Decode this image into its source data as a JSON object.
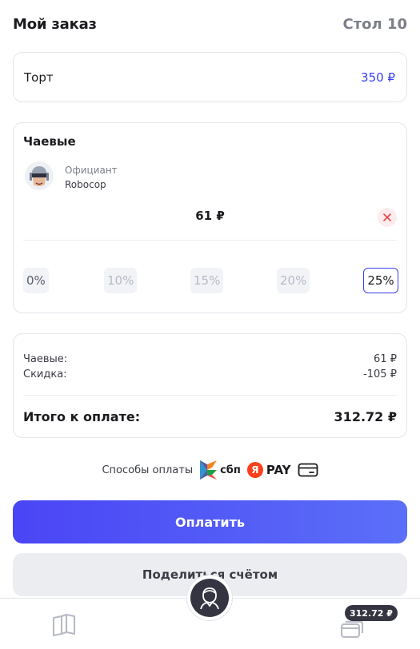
{
  "header": {
    "title": "Мой заказ",
    "table": "Стол 10"
  },
  "order": {
    "items": [
      {
        "name": "Торт",
        "price": "350 ₽"
      }
    ]
  },
  "tips": {
    "title": "Чаевые",
    "waiter_role": "Официант",
    "waiter_name": "Robocop",
    "amount": "61 ₽",
    "options": [
      "0%",
      "10%",
      "15%",
      "20%",
      "25%"
    ],
    "selected": "25%"
  },
  "summary": {
    "tips_label": "Чаевые:",
    "tips_value": "61 ₽",
    "discount_label": "Скидка:",
    "discount_value": "-105 ₽",
    "total_label": "Итого к оплате:",
    "total_value": "312.72 ₽"
  },
  "payment": {
    "label": "Способы оплаты",
    "sbp": "сбп",
    "yandex_letter": "Я",
    "yandex_pay": "PAY"
  },
  "buttons": {
    "pay": "Оплатить",
    "split": "Поделиться счётом"
  },
  "bottom_bar": {
    "cart_badge": "312.72 ₽"
  },
  "colors": {
    "accent": "#3a3df0",
    "button_gradient_start": "#4a45f5",
    "button_gradient_end": "#5b6ff8",
    "danger": "#e5484d"
  }
}
